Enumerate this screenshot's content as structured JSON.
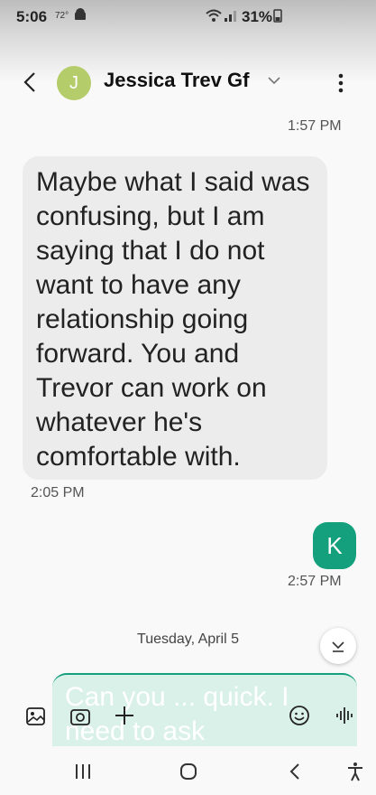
{
  "status_bar": {
    "time": "5:06",
    "temperature": "72°",
    "battery": "31%"
  },
  "header": {
    "avatar_letter": "J",
    "contact_name": "Jessica Trev Gf"
  },
  "messages": {
    "time_top": "1:57 PM",
    "incoming_text": "Maybe what I said was confusing, but I am saying that I do not want to have any relationship going forward. You and Trevor can work on whatever he's comfortable with.",
    "incoming_time": "2:05 PM",
    "outgoing_avatar_letter": "K",
    "outgoing_time": "2:57 PM",
    "date_separator": "Tuesday, April 5"
  },
  "composer": {
    "draft_text": "Can you ... quick. I need to ask"
  },
  "colors": {
    "accent": "#14a07c",
    "avatar_j": "#b5cc6a",
    "incoming_bubble": "#ececec"
  }
}
